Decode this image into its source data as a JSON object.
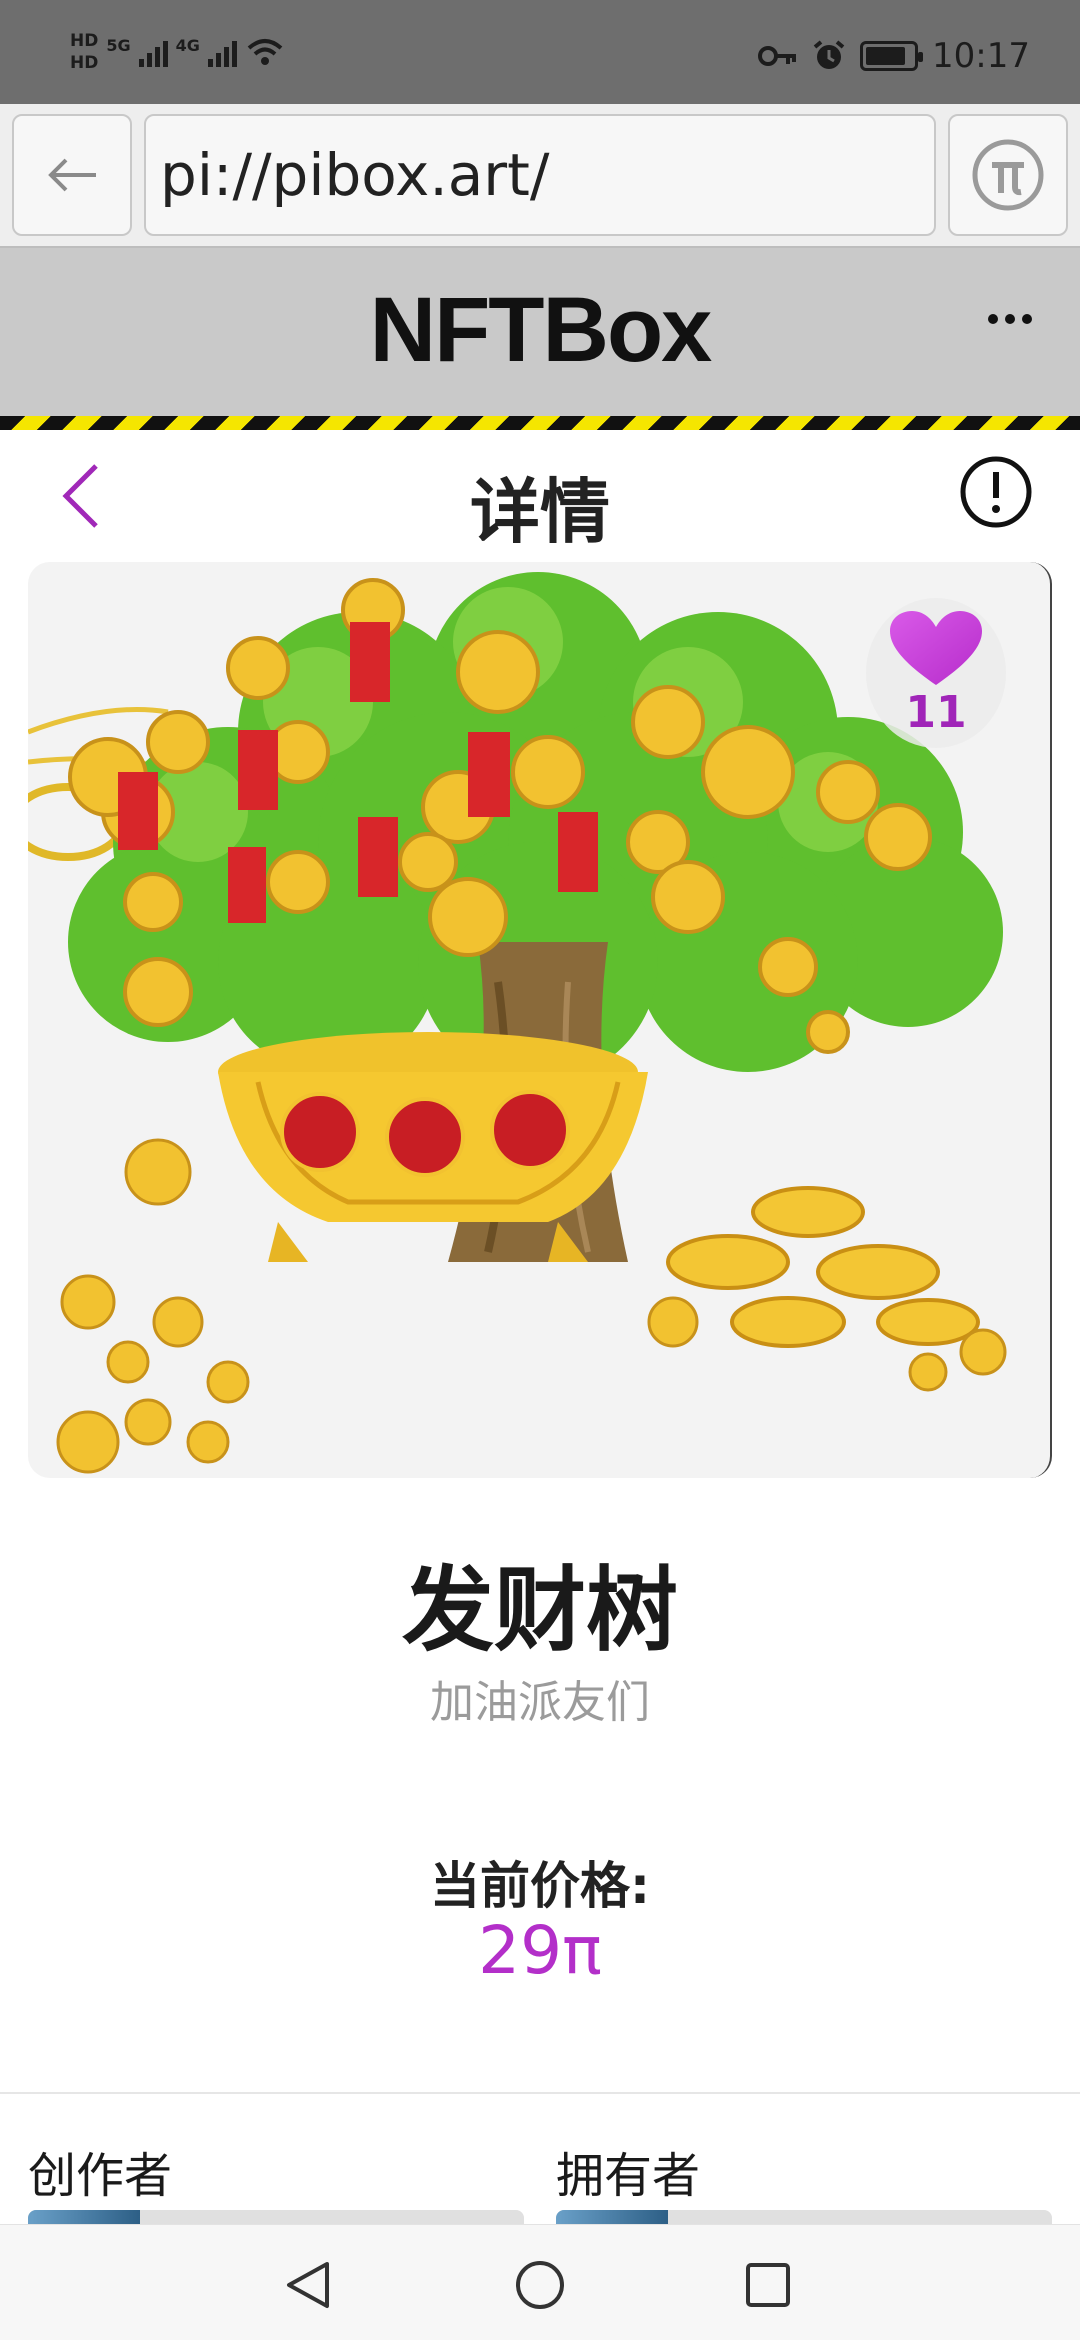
{
  "status_bar": {
    "hd1": "HD",
    "hd2": "HD",
    "net1": "5G",
    "net2": "4G",
    "time": "10:17",
    "battery_level": 0.85
  },
  "browser": {
    "url": "pi://pibox.art/",
    "back_icon": "arrow-left-icon",
    "pi_icon": "pi-coin-icon"
  },
  "app": {
    "brand": "NFTBox",
    "menu_icon": "more-dots-icon"
  },
  "page": {
    "title": "详情",
    "back_icon": "chevron-left-icon",
    "info_icon": "info-circle-icon"
  },
  "nft": {
    "likes": "11",
    "name": "发财树",
    "subtitle": "加油派友们",
    "price_label": "当前价格:",
    "price": "29π",
    "accent": "#b32fc9"
  },
  "people": {
    "creator_label": "创作者",
    "owner_label": "拥有者"
  },
  "nav": {
    "back": "nav-back-icon",
    "home": "nav-home-icon",
    "recents": "nav-recents-icon"
  }
}
